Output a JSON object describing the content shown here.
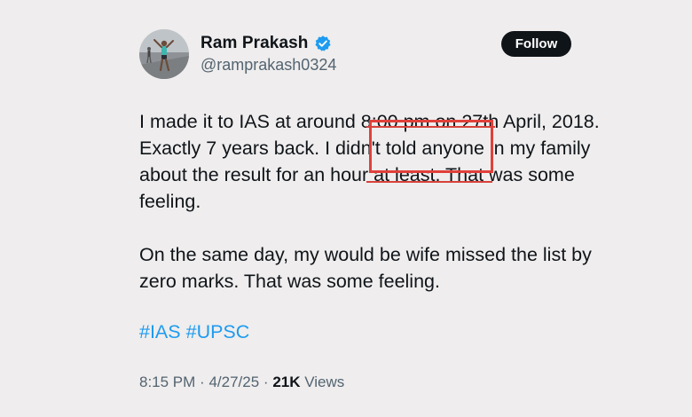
{
  "author": {
    "display_name": "Ram Prakash",
    "handle": "@ramprakash0324",
    "verified_icon": "verified-badge-icon",
    "avatar_icon": "profile-photo"
  },
  "follow_button": {
    "label": "Follow"
  },
  "tweet": {
    "paragraph_1": "I made it to IAS at around 8:00 pm on 27th April, 2018. Exactly 7 years back. I didn't told anyone in my family about the result for an hour at least. That was some feeling.",
    "paragraph_2": "On the same day, my would be wife missed the list by zero marks. That was some feeling.",
    "hashtag_1": "#IAS",
    "hashtag_2": "#UPSC"
  },
  "meta": {
    "time": "8:15 PM",
    "separator_1": "·",
    "date": "4/27/25",
    "separator_2": "·",
    "views_count": "21K",
    "views_label": "Views"
  },
  "colors": {
    "background": "#efeded",
    "text": "#0f1419",
    "secondary": "#536471",
    "link": "#1d9bf0",
    "verified": "#1d9bf0",
    "annotation": "#e0403a"
  }
}
